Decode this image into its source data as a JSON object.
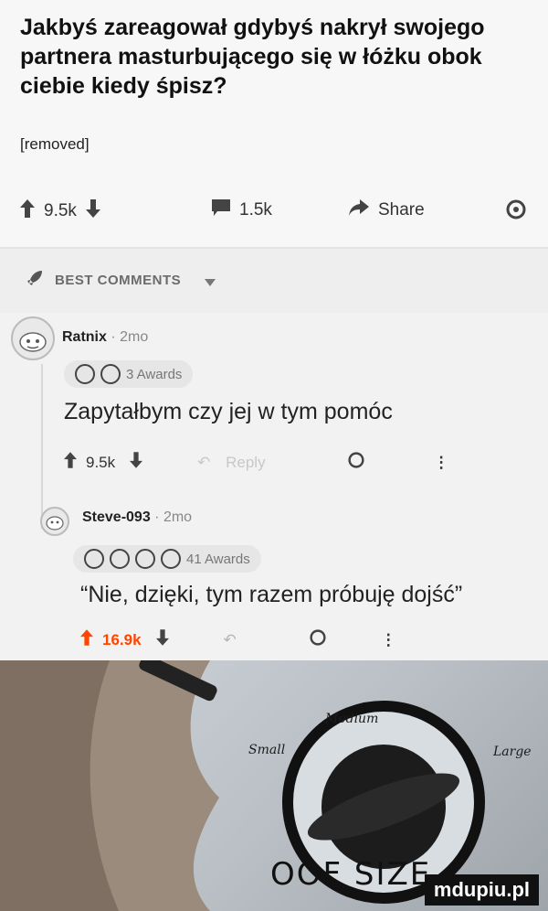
{
  "post": {
    "title": "Jakbyś zareagował gdybyś nakrył swojego partnera masturbującego się w łóżku obok ciebie kiedy śpisz?",
    "body": "[removed]",
    "upvotes": "9.5k",
    "comments_count": "1.5k",
    "share_label": "Share"
  },
  "best_comments": {
    "label": "BEST COMMENTS"
  },
  "comments": [
    {
      "user": "Ratnix",
      "time": "· 2mo",
      "awards": "3 Awards",
      "text": "Zapytałbym czy jej w tym pomóc",
      "score": "9.5k",
      "reply_label": "Reply"
    },
    {
      "user": "Steve-093",
      "time": "· 2mo",
      "awards": "41 Awards",
      "text": "“Nie, dzięki, tym razem próbuję dojść”",
      "score": "16.9k"
    }
  ],
  "meme": {
    "labels": {
      "small": "Small",
      "medium": "Medium",
      "large": "Large",
      "caption": "OOF SIZE"
    },
    "watermark": "mdupiu.pl"
  },
  "colors": {
    "upvote_active": "#ff4500",
    "award_gold": "#c9a227"
  }
}
